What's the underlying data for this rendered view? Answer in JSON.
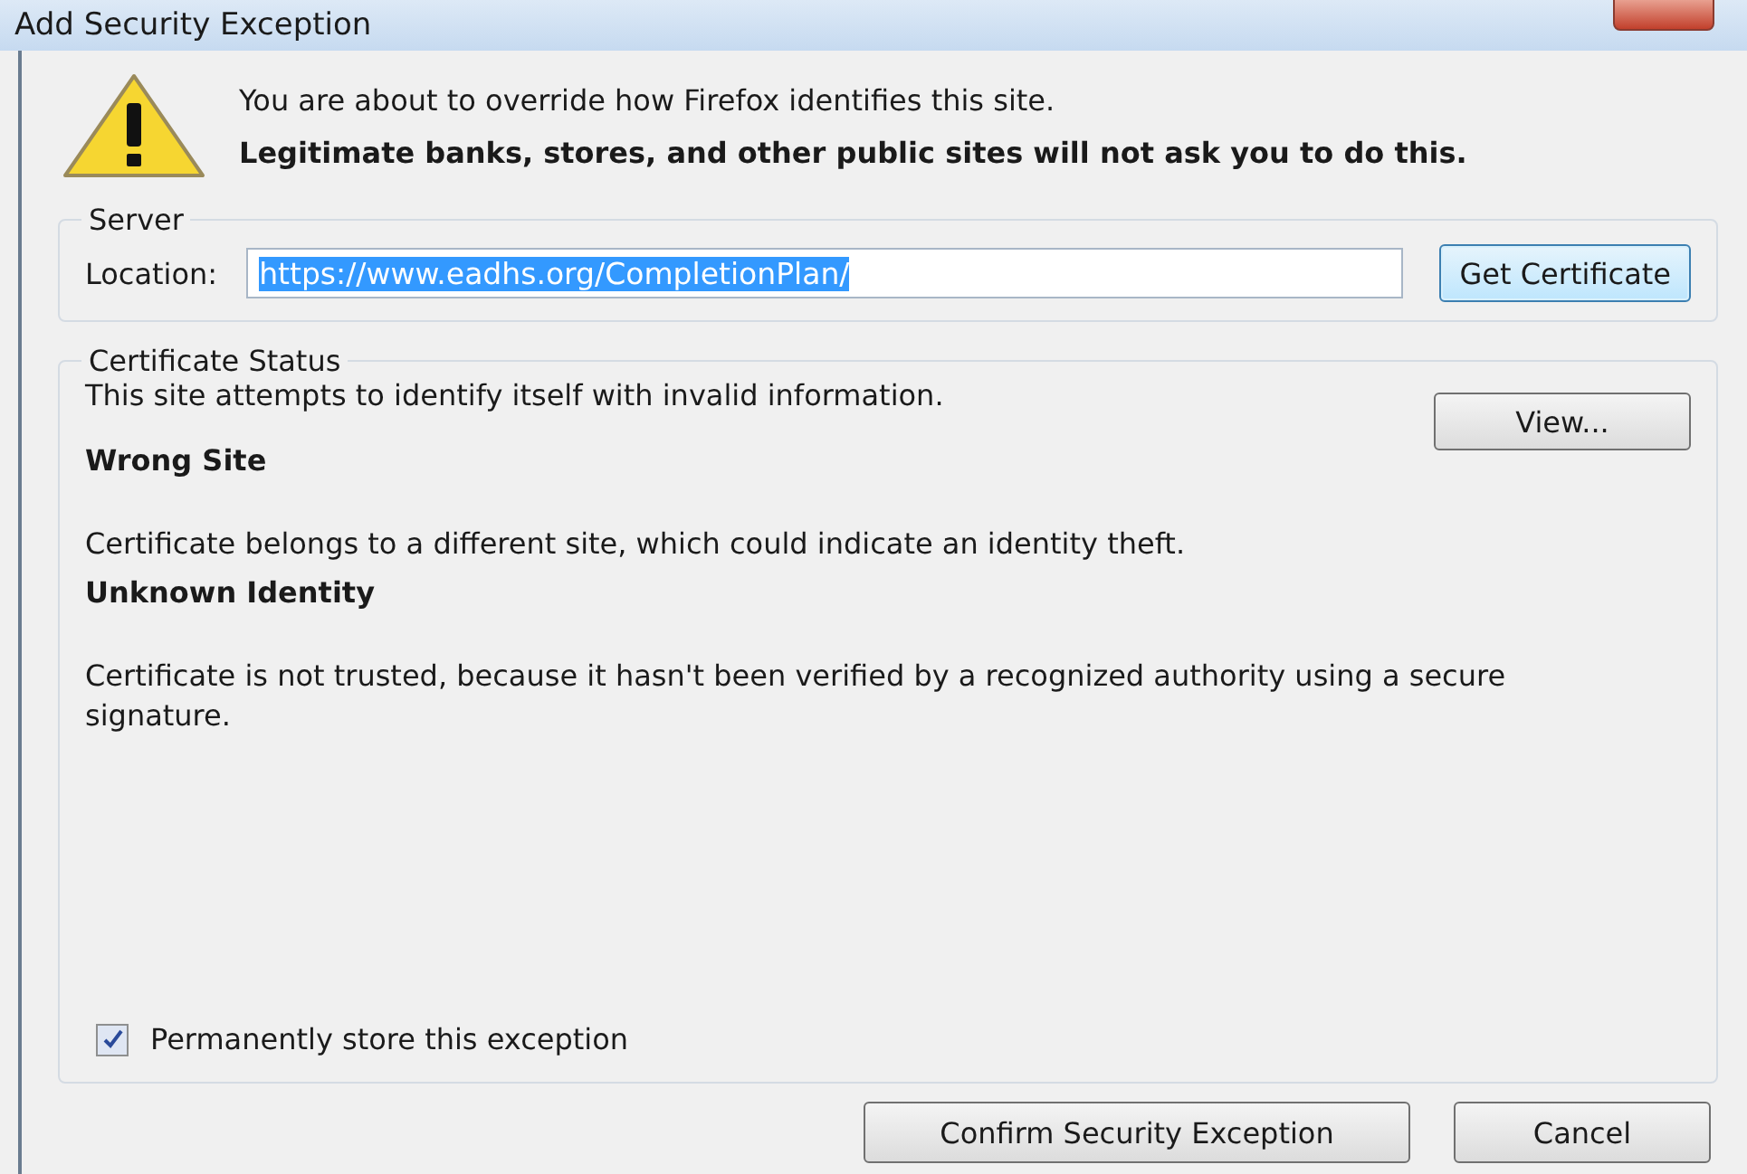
{
  "window": {
    "title": "Add Security Exception"
  },
  "intro": {
    "line": "You are about to override how Firefox identifies this site.",
    "warning": "Legitimate banks, stores, and other public sites will not ask you to do this."
  },
  "server": {
    "legend": "Server",
    "location_label": "Location:",
    "location_value": "https://www.eadhs.org/CompletionPlan/",
    "button": "Get Certificate"
  },
  "status": {
    "legend": "Certificate Status",
    "summary": "This site attempts to identify itself with invalid information.",
    "view_button": "View...",
    "problems": [
      {
        "heading": "Wrong Site",
        "text": "Certificate belongs to a different site, which could indicate an identity theft."
      },
      {
        "heading": "Unknown Identity",
        "text": "Certificate is not trusted, because it hasn't been verified by a recognized authority using a secure signature."
      }
    ],
    "permanent": {
      "label": "Permanently store this exception",
      "checked": true
    }
  },
  "buttons": {
    "confirm": "Confirm Security Exception",
    "cancel": "Cancel"
  }
}
